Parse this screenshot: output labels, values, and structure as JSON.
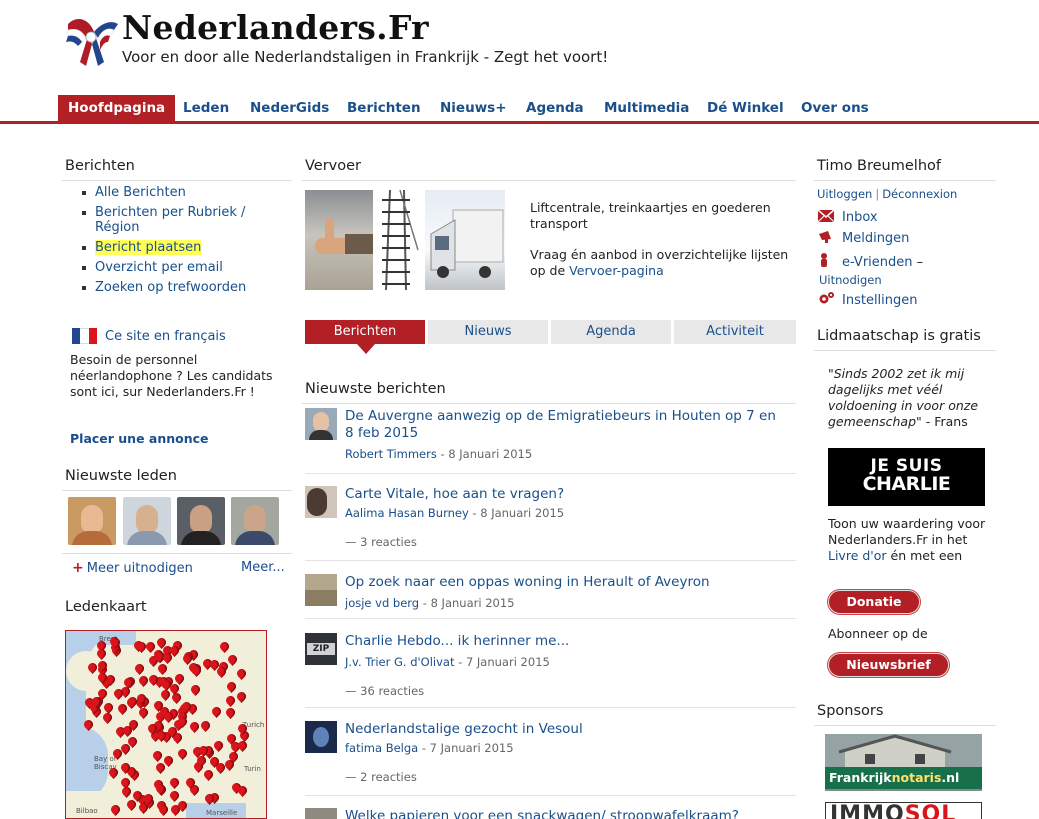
{
  "header": {
    "title": "Nederlanders.Fr",
    "tagline": "Voor en door alle Nederlandstaligen in Frankrijk - Zegt het voort!"
  },
  "nav": [
    {
      "label": "Hoofdpagina",
      "active": true
    },
    {
      "label": "Leden"
    },
    {
      "label": "NederGids"
    },
    {
      "label": "Berichten"
    },
    {
      "label": "Nieuws+"
    },
    {
      "label": "Agenda"
    },
    {
      "label": "Multimedia"
    },
    {
      "label": "Dé Winkel"
    },
    {
      "label": "Over ons"
    }
  ],
  "left": {
    "berichten_heading": "Berichten",
    "berichten_links": [
      "Alle Berichten",
      "Berichten per Rubriek / Région",
      "Bericht plaatsen",
      "Overzicht per email",
      "Zoeken op trefwoorden"
    ],
    "highlighted_index": 2,
    "french_site": "Ce site en français",
    "french_desc": "Besoin de personnel néerlandophone ? Les candidats sont ici, sur Nederlanders.Fr !",
    "placer_annonce": "Placer une annonce",
    "nieuwste_leden_heading": "Nieuwste leden",
    "meer_uitnodigen": "Meer uitnodigen",
    "meer": "Meer...",
    "ledenkaart_heading": "Ledenkaart",
    "map_labels": [
      "Brest",
      "Bay of Biscay",
      "Bilbao",
      "Marseille",
      "Turin",
      "Zurich"
    ]
  },
  "middle": {
    "vervoer_heading": "Vervoer",
    "vervoer_desc": "Liftcentrale, treinkaartjes en goederen transport",
    "vervoer_desc2": "Vraag én aanbod in overzichtelijke lijsten op de",
    "vervoer_link": "Vervoer-pagina",
    "tabs": [
      "Berichten",
      "Nieuws",
      "Agenda",
      "Activiteit"
    ],
    "newest_heading": "Nieuwste berichten",
    "posts": [
      {
        "title": "De Auvergne aanwezig op de Emigratiebeurs in Houten op 7 en 8 feb 2015",
        "author": "Robert Timmers",
        "date": " - 8 Januari 2015",
        "reacties": ""
      },
      {
        "title": "Carte Vitale, hoe aan te vragen?",
        "author": "Aalima Hasan Burney",
        "date": " - 8 Januari 2015",
        "reacties": "— 3 reacties"
      },
      {
        "title": "Op zoek naar een oppas woning in Herault of Aveyron",
        "author": "josje vd berg",
        "date": " - 8 Januari 2015",
        "reacties": ""
      },
      {
        "title": "Charlie Hebdo... ik herinner me...",
        "author": "J.v. Trier G. d'Olivat",
        "date": " - 7 Januari 2015",
        "reacties": "— 36 reacties"
      },
      {
        "title": "Nederlandstalige gezocht in Vesoul",
        "author": "fatima Belga",
        "date": " - 7 Januari 2015",
        "reacties": "— 2 reacties"
      },
      {
        "title": "Welke papieren voor een snackwagen/ stroopwafelkraam?",
        "author": "",
        "date": "",
        "reacties": ""
      }
    ]
  },
  "right": {
    "user_name": "Timo Breumelhof",
    "uitloggen": "Uitloggen",
    "deconnexion": "Déconnexion",
    "sep": "|",
    "inbox": "Inbox",
    "meldingen": "Meldingen",
    "evrienden": "e-Vrienden",
    "evrienden_dash": " –",
    "uitnodigen": "Uitnodigen",
    "instellingen": "Instellingen",
    "lidmaatschap_heading": "Lidmaatschap is gratis",
    "quote": "\"Sinds 2002 zet ik mij dagelijks met véél voldoening in voor onze gemeenschap\"",
    "quote_author": " - Frans",
    "charlie_line1": "JE SUIS",
    "charlie_line2": "CHARLIE",
    "waardering_pre": "Toon uw waardering voor Nederlanders.Fr in het",
    "livre_dor": "Livre d'or",
    "waardering_post": "én met een",
    "donatie": "Donatie",
    "abonneer": "Abonneer op de",
    "nieuwsbrief": "Nieuwsbrief",
    "sponsors_heading": "Sponsors",
    "sponsor1_pre": "Frankrijk",
    "sponsor1_bold": "notaris",
    "sponsor1_post": ".nl",
    "sponsor2_pre": "IMMO",
    "sponsor2_red": "SOL"
  },
  "colors": {
    "accent": "#b21f25",
    "link": "#1a4f8b",
    "highlight": "#ffff55"
  }
}
